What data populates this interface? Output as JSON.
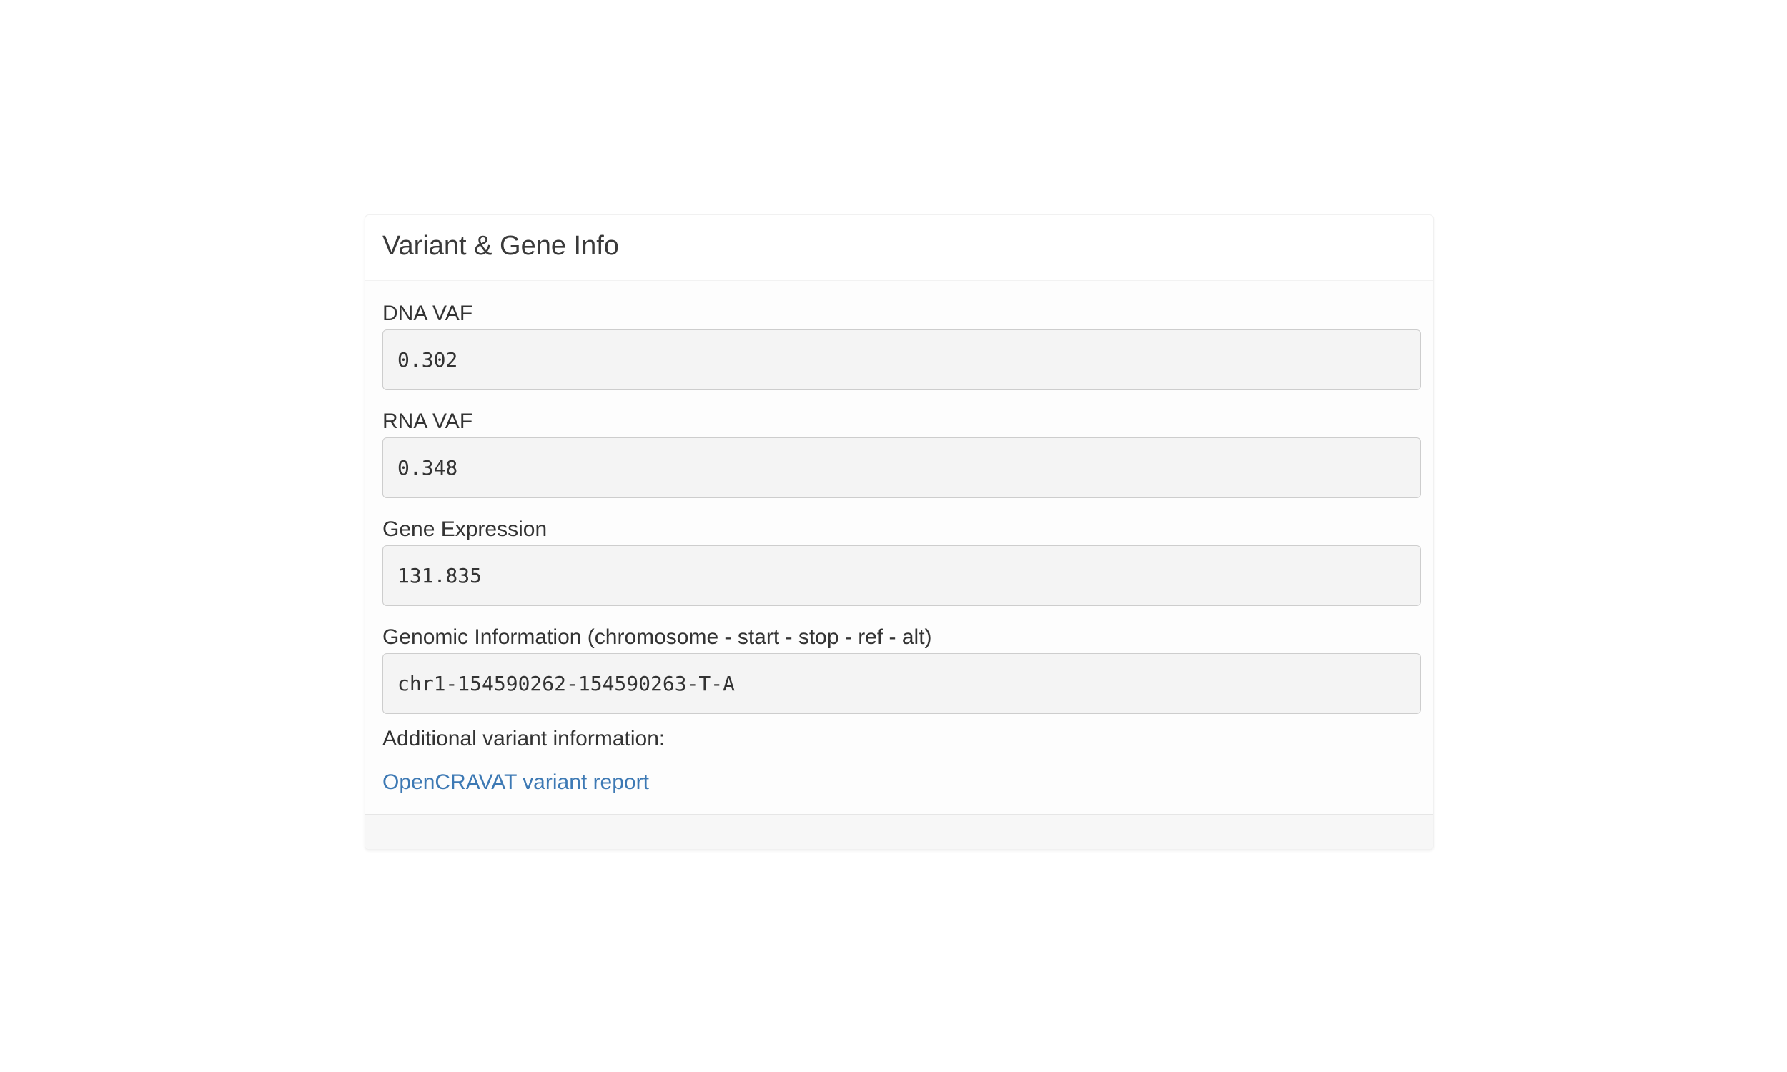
{
  "panel": {
    "title": "Variant & Gene Info",
    "fields": [
      {
        "label": "DNA VAF",
        "value": "0.302"
      },
      {
        "label": "RNA VAF",
        "value": "0.348"
      },
      {
        "label": "Gene Expression",
        "value": "131.835"
      },
      {
        "label": "Genomic Information (chromosome - start - stop - ref - alt)",
        "value": "chr1-154590262-154590263-T-A"
      }
    ],
    "additional_label": "Additional variant information:",
    "link_text": "OpenCRAVAT variant report"
  }
}
